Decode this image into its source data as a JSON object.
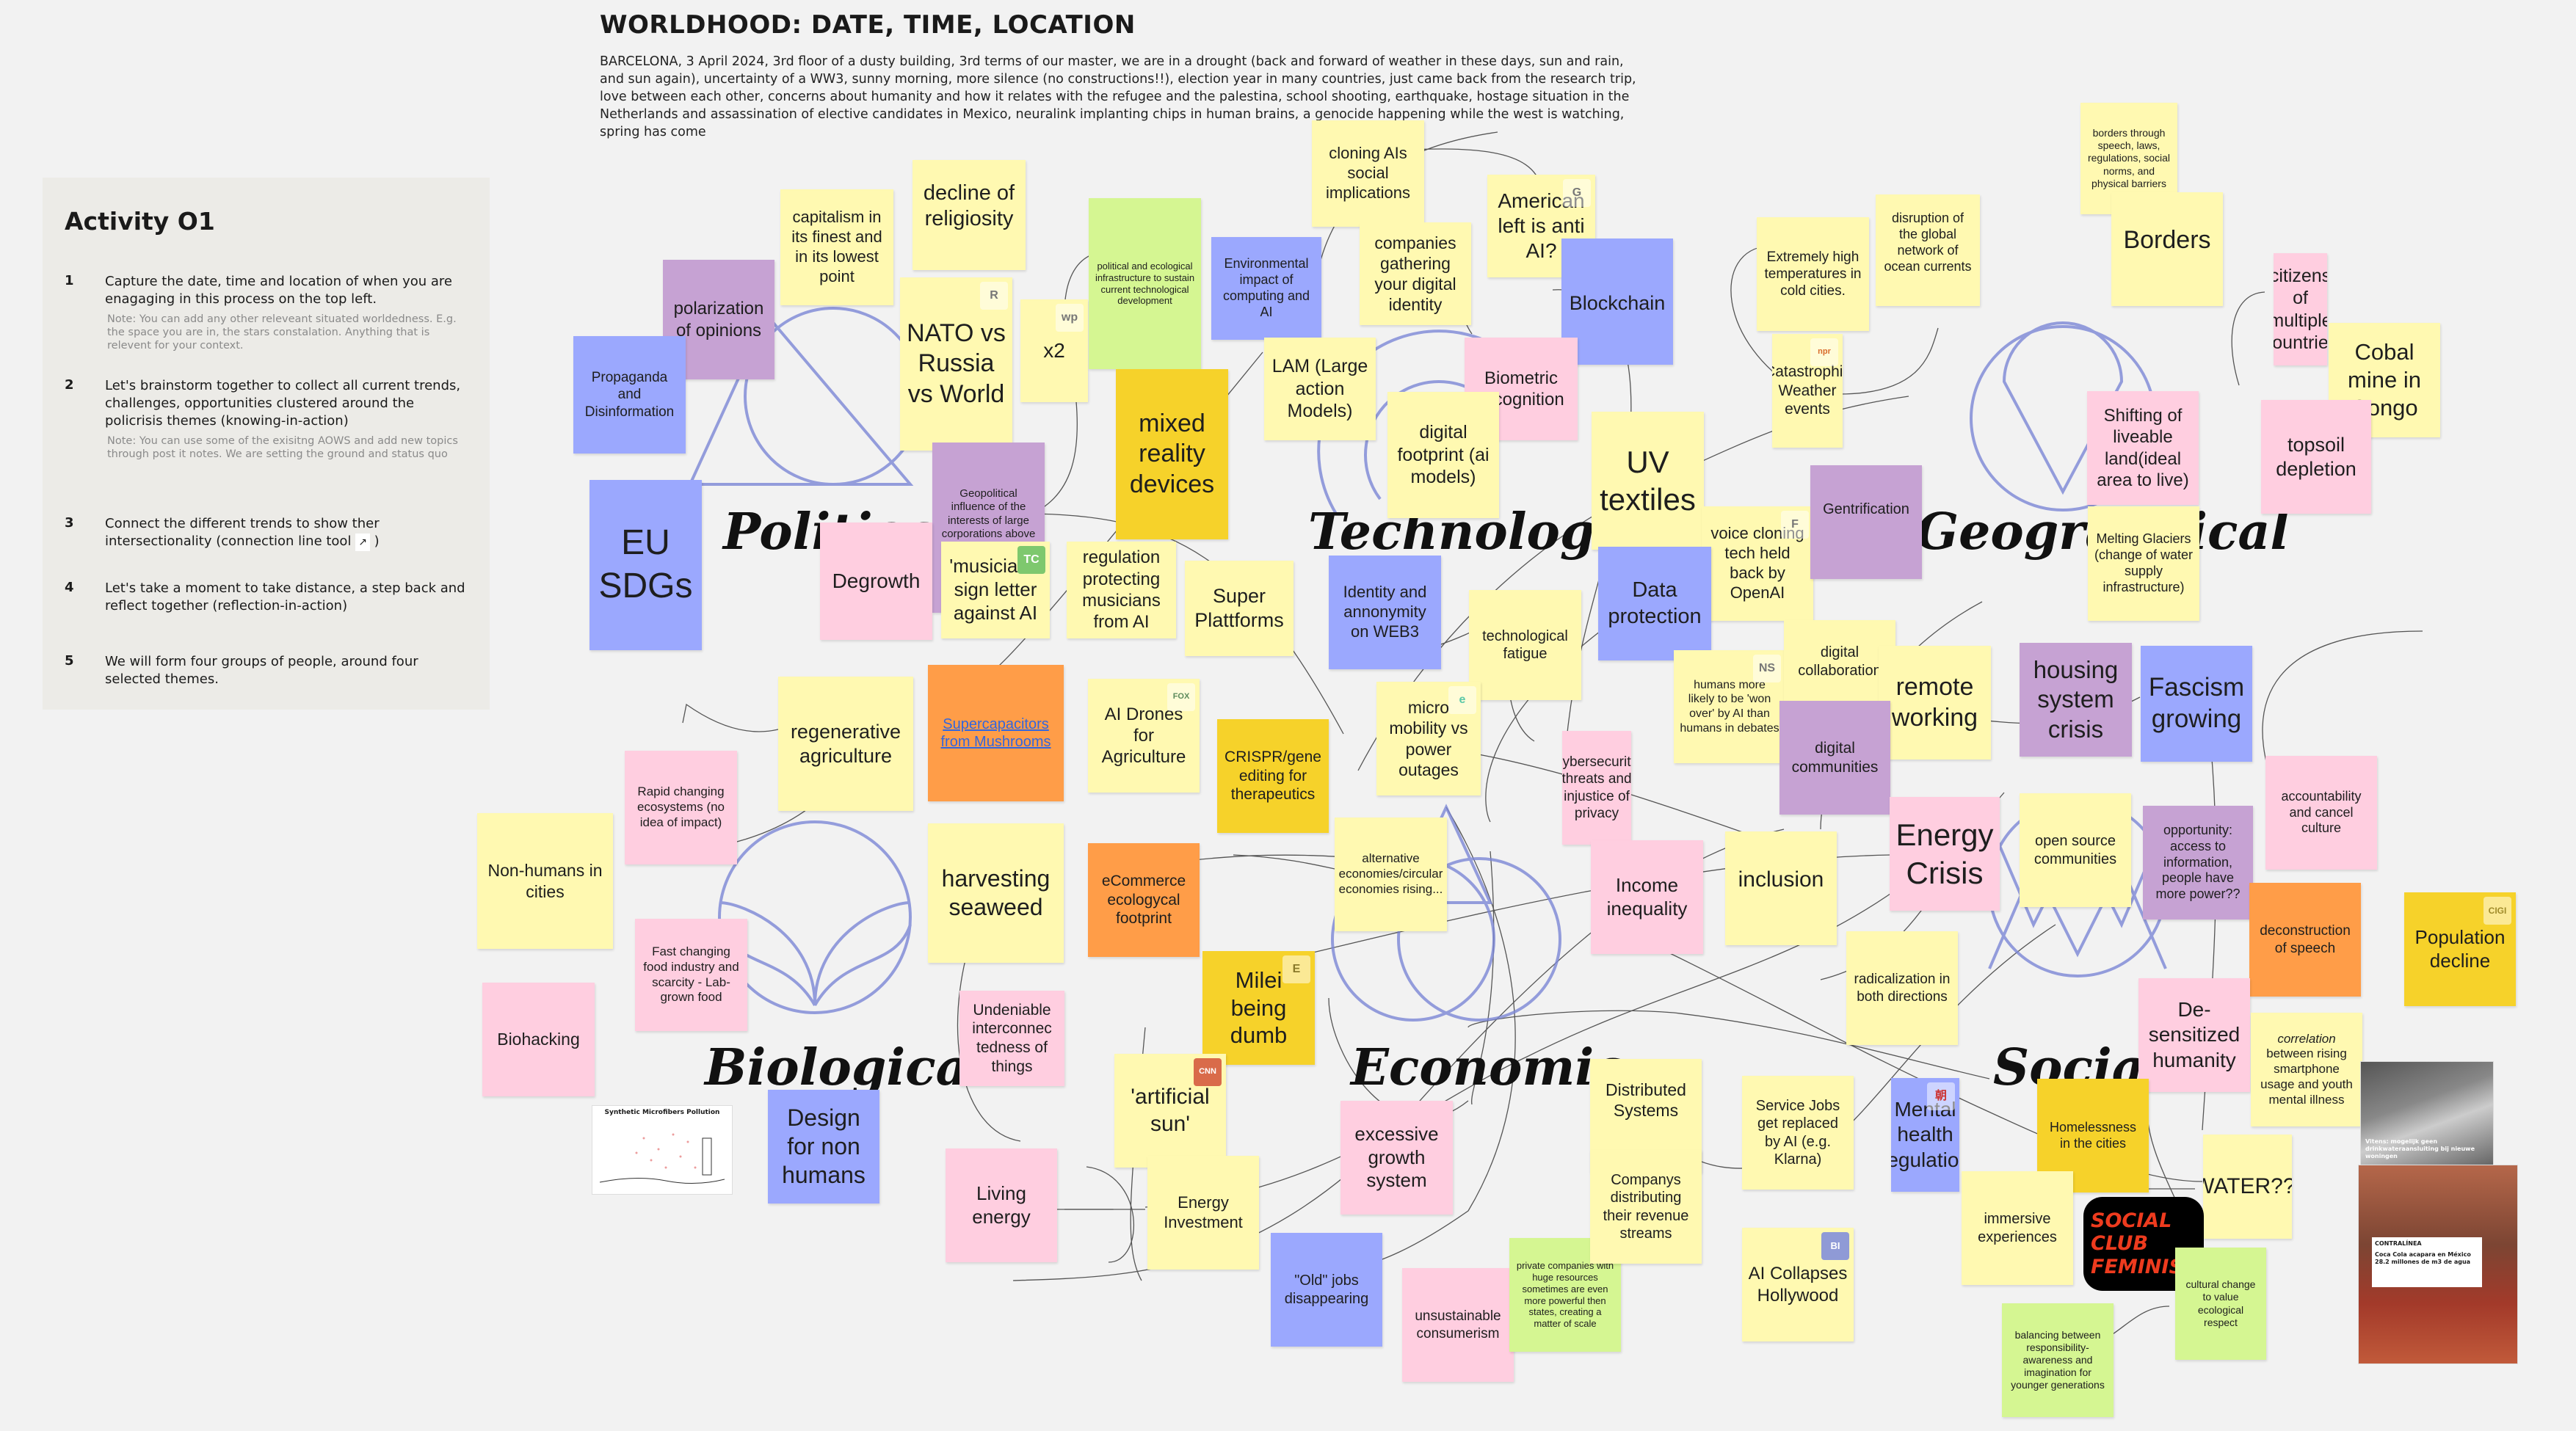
{
  "board": {
    "title": "WORLDHOOD: DATE, TIME, LOCATION",
    "context": "BARCELONA, 3 April 2024, 3rd floor of a dusty building, 3rd terms of our master, we are in a drought (back and forward of weather in these days, sun and rain, and sun again), uncertainty of a WW3, sunny morning, more silence (no constructions!!), election year in many countries, just came back from the research trip, love between each other, concerns about humanity and how it relates with the refugee and the palestina, school shooting, earthquake, hostage situation in the Netherlands and assassination of elective candidates in Mexico, neuralink implanting chips in human brains, a genocide happening while the west is watching, spring has come"
  },
  "activity": {
    "title": "Activity O1",
    "steps": [
      {
        "num": "1",
        "text": "Capture the date, time and location of when you are enagaging in this process on the top left.",
        "note": "Note: You can add any other releveant situated worldedness. E.g. the space you are in, the stars constalation. Anything that is relevent for your context."
      },
      {
        "num": "2",
        "text": "Let's brainstorm together to collect all current trends, challenges, opportunities clustered around the policrisis themes (knowing-in-action)",
        "note": "Note: You can use some of the exisitng AOWS and add new topics through post it notes. We are setting the ground and status quo"
      },
      {
        "num": "3",
        "text": "Connect the different trends to show ther intersectionality (connection line tool",
        "tool_icon": "↗",
        "text_end": ")"
      },
      {
        "num": "4",
        "text": "Let's take a moment to take distance, a step back and reflect together (reflection-in-action)"
      },
      {
        "num": "5",
        "text": "We will form four groups of people, around four selected themes."
      }
    ]
  },
  "themes": {
    "political": "Political",
    "technological": "Technological",
    "geographical": "Geographical",
    "biological": "Biological",
    "economic": "Economic",
    "social": "Social"
  },
  "colors": {
    "yellow": "#fff9b1",
    "pink": "#ffcee0",
    "violet": "#c6a2d3",
    "blue": "#9ba8fe",
    "orange": "#ff9d48",
    "green": "#d5f692",
    "gold": "#f6d22a",
    "symbol": "#7c87d6"
  },
  "notes": {
    "capitalism": "capitalism in its finest and in its lowest point",
    "religiosity": "decline of religiosity",
    "polarization": "polarization of opinions",
    "propaganda": "Propaganda and Disinformation",
    "nato": "NATO vs Russia vs World",
    "x2": "x2",
    "polinfra": "political and ecological infrastructure to sustain current technological development",
    "eusdgs": "EU SDGs",
    "geopolitical": "Geopolitical influence of the interests of large corporations above democratic governments",
    "mixedreality": "mixed reality devices",
    "degrowth": "Degrowth",
    "musicians": "'musicians' sign letter against AI",
    "regulation": "regulation protecting musicians from AI",
    "superplatforms": "Super Plattforms",
    "cloningais": "cloning AIs social implications",
    "americanleft": "American left is anti AI?",
    "environmental": "Environmental impact of computing and AI",
    "companiesgathering": "companies gathering your digital identity",
    "blockchain": "Blockchain",
    "lam": "LAM (Large action Models)",
    "biometric": "Biometric recognition",
    "digitalfootprint": "digital footprint (ai models)",
    "uvtextiles": "UV textiles",
    "voicecloning": "voice cloning tech held back by OpenAI",
    "identityweb3": "Identity and annonymity on WEB3",
    "techfatigue": "technological fatigue",
    "dataprotection": "Data protection",
    "humanswon": "humans more likely to be 'won over' by AI than humans in debates",
    "digitalcollab": "digital collaboration",
    "remoteworking": "remote working",
    "digitalcommunities": "digital communities",
    "micromobility": "micro mobility vs power outages",
    "cybersecurity": "cybersecurity threats and injustice of privacy",
    "bordersthrough": "borders through speech, laws, regulations, social norms, and physical barriers",
    "extremetemps": "Extremely high temperatures in cold cities.",
    "oceancurrents": "disruption of the global network of ocean currents",
    "borders": "Borders",
    "citizens": "citizens of multiple countries",
    "cobalt": "Cobal mine in Congo",
    "catastrophic": "Catastrophic Weather events",
    "shifting": "Shifting of liveable land(ideal area to live)",
    "topsoil": "topsoil depletion",
    "gentrification": "Gentrification",
    "glaciers": "Melting Glaciers (change of water supply infrastructure)",
    "housing": "housing system crisis",
    "fascism": "Fascism growing",
    "accountability": "accountability and cancel culture",
    "opportunity": "opportunity: access to information, people have more power??",
    "deconstruction": "deconstruction of speech",
    "population": "Population decline",
    "opensource": "open source communities",
    "energycrisis": "Energy Crisis",
    "desensitized": "De-sensitized humanity",
    "correlation_em": "correlation",
    "correlation": "between rising smartphone usage and youth mental illness",
    "water": "WATER??!",
    "rapid": "Rapid changing ecosystems (no idea of impact)",
    "regenerative": "regenerative agriculture",
    "supercapacitors": "Supercapacitors from Mushrooms",
    "aidrones": "AI Drones for Agriculture",
    "crispr": "CRISPR/gene editing for therapeutics",
    "nonhumans": "Non-humans in cities",
    "harvesting": "harvesting seaweed",
    "ecommerce": "eCommerce ecologycal footprint",
    "fastchanging": "Fast changing food industry and scarcity - Lab-grown food",
    "biohacking": "Biohacking",
    "microfibers": "Synthetic Microfibers Pollution",
    "designnonhumans": "Design for non humans",
    "undeniable": "Undeniable interconnec tedness of things",
    "milei": "Milei being dumb",
    "artificialsun": "'artificial sun'",
    "livingenergy": "Living energy",
    "energyinvestment": "Energy Investment",
    "alternative": "alternative economies/circular economies rising...",
    "excessive": "excessive growth system",
    "oldjobs": "\"Old\" jobs disappearing",
    "unsustainable": "unsustainable consumerism",
    "privatecompanies": "private companies with huge resources sometimes are even more powerful then states, creating a matter of scale",
    "incomeineq": "Income inequality",
    "inclusion": "inclusion",
    "radicalization": "radicalization in both directions",
    "distributed": "Distributed Systems",
    "companys": "Companys distributing their revenue streams",
    "servicejobs": "Service Jobs get replaced by AI (e.g. Klarna)",
    "aicollapses": "AI Collapses Hollywood",
    "mentalhealth": "Mental health regulation",
    "homelessness": "Homelessness in the cities",
    "immersive": "immersive experiences",
    "socialclub1": "SOCIAL CLUB",
    "socialclub2": "FEMINISM",
    "balancing": "balancing between responsibility-awareness and imagination for younger generations",
    "cultural": "cultural change to value ecological respect"
  },
  "badges": {
    "nato": "R",
    "x2": "wp",
    "musicians": "TC",
    "americanleft": "G",
    "voicecloning": "F",
    "humanswon": "NS",
    "micromobility": "e",
    "catastrophic": "npr",
    "aidrones": "FOX",
    "milei": "E",
    "artificialsun": "CNN",
    "aicollapses": "BI",
    "mentalhealth": "朝",
    "population": "CIGI"
  },
  "images": {
    "water_caption": "Vitens: mogelijk geen drinkwateraansluiting bij nieuwe woningen",
    "coca_source": "CONTRALÍNEA",
    "coca_headline": "Coca Cola acapara en México 28.2 millones de m3 de agua"
  }
}
